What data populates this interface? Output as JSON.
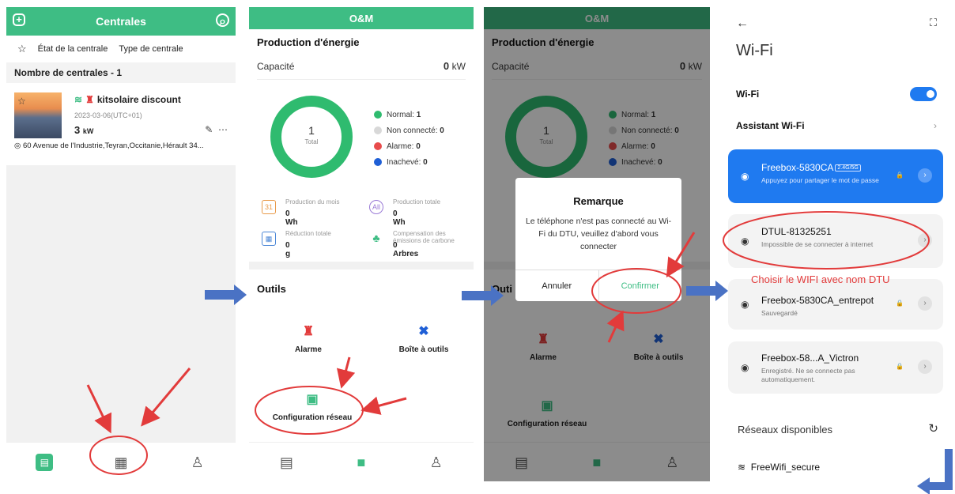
{
  "phone1": {
    "header_title": "Centrales",
    "filters": [
      "État de la centrale",
      "Type de centrale"
    ],
    "count_label": "Nombre de centrales - 1",
    "plant": {
      "name": "kitsolaire discount",
      "date": "2023-03-06(UTC+01)",
      "capacity_value": "3",
      "capacity_unit": "kW",
      "address": "60 Avenue de l'Industrie,Teyran,Occitanie,Hérault 34..."
    }
  },
  "phone2": {
    "header_title": "O&M",
    "section_energy": "Production d'énergie",
    "capacity_label": "Capacité",
    "capacity_value": "0",
    "capacity_unit": "kW",
    "donut_value": "1",
    "donut_label": "Total",
    "legend": [
      {
        "label": "Normal:",
        "value": "1",
        "color": "#2fbb6f"
      },
      {
        "label": "Non connecté:",
        "value": "0",
        "color": "#d8d8d8"
      },
      {
        "label": "Alarme:",
        "value": "0",
        "color": "#e84c4c"
      },
      {
        "label": "Inachevé:",
        "value": "0",
        "color": "#1f5fd6"
      }
    ],
    "stats": [
      {
        "label": "Production du mois",
        "value": "0 Wh",
        "icon": "31"
      },
      {
        "label": "Production totale",
        "value": "0 Wh",
        "icon": "All"
      },
      {
        "label": "Réduction totale",
        "value": "0 g",
        "icon": "co2"
      },
      {
        "label": "Compensation des émissions de carbone",
        "value": "0 Arbres",
        "icon": "tree"
      }
    ],
    "section_tools": "Outils",
    "tools": {
      "alarm": "Alarme",
      "toolbox": "Boîte à outils",
      "network": "Configuration réseau"
    }
  },
  "phone3": {
    "dialog": {
      "title": "Remarque",
      "message": "Le téléphone n'est pas connecté au Wi-Fi du DTU, veuillez d'abord vous connecter",
      "cancel": "Annuler",
      "confirm": "Confirmer"
    },
    "tools_label_partial": "Outi"
  },
  "phone4": {
    "title": "Wi-Fi",
    "wifi_label": "Wi-Fi",
    "assistant_label": "Assistant Wi-Fi",
    "networks": [
      {
        "name": "Freebox-5830CA",
        "badge": "2.4G/5G",
        "status": "Appuyez pour partager le mot de passe"
      },
      {
        "name": "DTUL-81325251",
        "status": "Impossible de se connecter à internet"
      },
      {
        "name": "Freebox-5830CA_entrepot",
        "status": "Sauvegardé"
      },
      {
        "name": "Freebox-58...A_Victron",
        "status": "Enregistré. Ne se connecte pas automatiquement."
      }
    ],
    "available_label": "Réseaux disponibles",
    "free_network": "FreeWifi_secure"
  },
  "annotation": {
    "note": "Choisir le WIFI avec nom DTU",
    "accent": "#e23b3b",
    "arrow_color": "#4a72c4"
  }
}
